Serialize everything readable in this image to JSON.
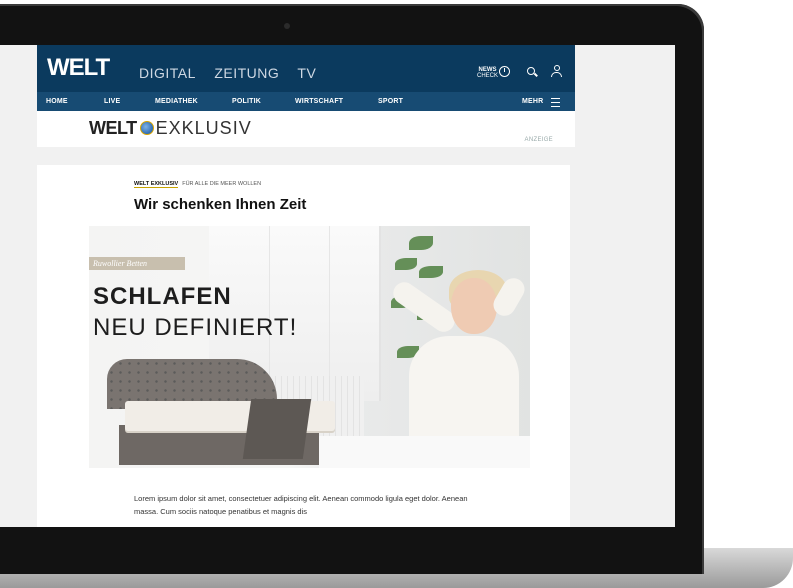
{
  "header": {
    "logo": "WELT",
    "nav": [
      "DIGITAL",
      "ZEITUNG",
      "TV"
    ],
    "newscheck_line1": "NEWS",
    "newscheck_line2": "CHECK"
  },
  "secondary_nav": {
    "items": [
      "HOME",
      "LIVE",
      "MEDIATHEK",
      "POLITIK",
      "WIRTSCHAFT",
      "SPORT"
    ],
    "more": "MEHR"
  },
  "ad_bar": {
    "logo_welt": "WELT",
    "logo_exklusiv": "EXKLUSIV",
    "label": "ANZEIGE"
  },
  "article": {
    "kicker_brand": "WELT EXKLUSIV",
    "kicker_text": "FÜR ALLE DIE MEER WOLLEN",
    "headline": "Wir schenken Ihnen Zeit",
    "hero": {
      "brand_tag": "Ruwollier Betten",
      "line1": "SCHLAFEN",
      "line2": "NEU DEFINIERT!"
    },
    "body": "Lorem ipsum dolor sit amet, consectetuer adipiscing elit. Aenean commodo ligula eget dolor. Aenean massa. Cum sociis natoque penatibus et magnis dis"
  },
  "colors": {
    "header_bg": "#0b3a5e",
    "subnav_bg": "#174b73"
  }
}
